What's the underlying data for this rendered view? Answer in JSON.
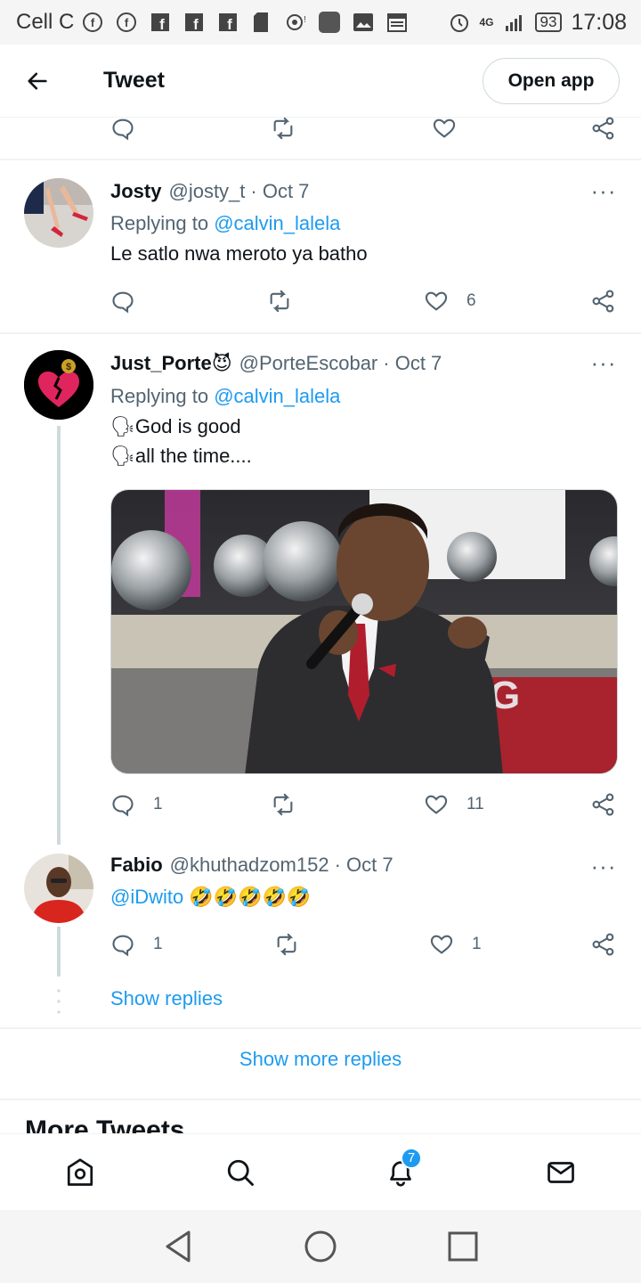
{
  "status_bar": {
    "carrier": "Cell C",
    "network": "4G",
    "battery": "93",
    "time": "17:08"
  },
  "header": {
    "title": "Tweet",
    "open_app": "Open app"
  },
  "tweets": [
    {
      "name": "Josty",
      "handle": "@josty_t",
      "date": "· Oct 7",
      "replying_prefix": "Replying to",
      "replying_to": "@calvin_lalela",
      "text": "Le satlo nwa meroto ya batho",
      "replies": "",
      "retweets": "",
      "likes": "6"
    },
    {
      "name": "Just_Porte😈",
      "handle": "@PorteEscobar",
      "date": "· Oct 7",
      "replying_prefix": "Replying to",
      "replying_to": "@calvin_lalela",
      "text_line1": "🗣God is good",
      "text_line2": "🗣all the time....",
      "replies": "1",
      "retweets": "",
      "likes": "11"
    },
    {
      "name": "Fabio",
      "handle": "@khuthadzom152",
      "date": "· Oct 7",
      "mention": "@iDwito",
      "emojis": "🤣🤣🤣🤣🤣",
      "replies": "1",
      "retweets": "",
      "likes": "1"
    }
  ],
  "thread": {
    "show_replies": "Show replies",
    "show_more_replies": "Show more replies",
    "more_tweets": "More Tweets"
  },
  "tabbar": {
    "notifications_badge": "7"
  },
  "colors": {
    "accent": "#1d9bf0",
    "secondary_text": "#536471",
    "divider": "#eff3f4"
  }
}
